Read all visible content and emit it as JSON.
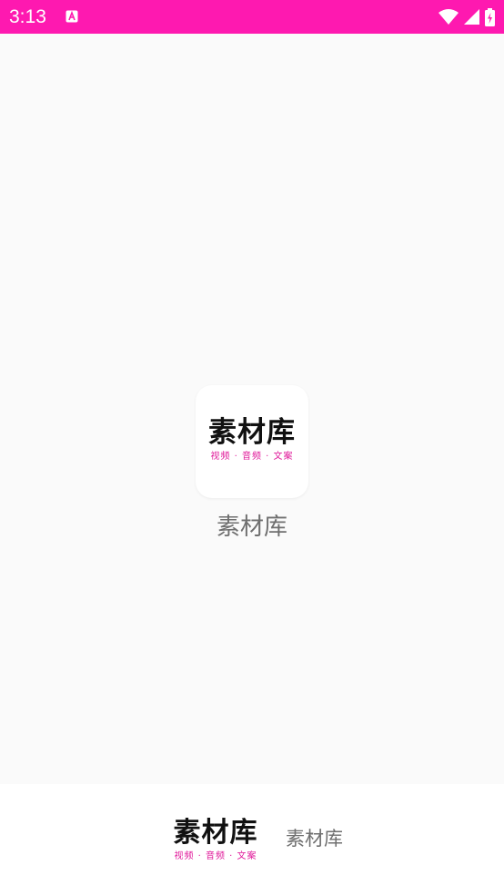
{
  "status_bar": {
    "time": "3:13",
    "background": "#fe19b0",
    "icons": [
      "notification-a-icon",
      "wifi-icon",
      "signal-icon",
      "battery-charging-icon"
    ]
  },
  "splash": {
    "logo_title": "素材库",
    "logo_subtitle": "视频 · 音频 · 文案",
    "app_name": "素材库"
  },
  "footer": {
    "logo_title": "素材库",
    "logo_subtitle": "视频 · 音频 · 文案",
    "app_name": "素材库"
  },
  "colors": {
    "accent": "#fe19b0",
    "logo_subtitle": "#e0199a",
    "background": "#fafafa",
    "text_gray": "#6f6f6f"
  }
}
